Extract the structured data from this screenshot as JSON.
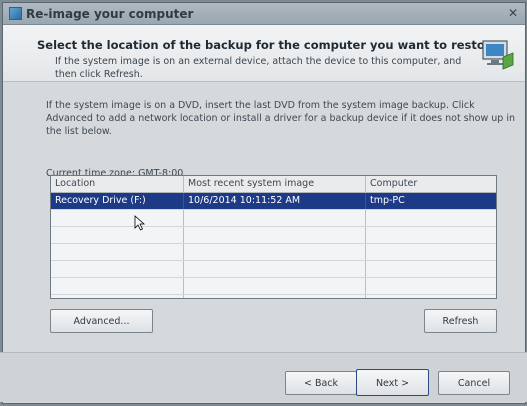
{
  "window": {
    "title": "Re-image your computer",
    "close_glyph": "✕"
  },
  "header": {
    "title": "Select the location of the backup for the computer you want to restore",
    "subtitle": "If the system image is on an external device, attach the device to this computer, and then click Refresh."
  },
  "body": {
    "instructions": "If the system image is on a DVD, insert the last DVD from the system image backup. Click Advanced to add a network location or install a driver for a backup device if it does not show up in the list below.",
    "timezone": "Current time zone: GMT-8:00"
  },
  "table": {
    "columns": [
      "Location",
      "Most recent system image",
      "Computer"
    ],
    "rows": [
      {
        "location": "Recovery Drive (F:)",
        "image": "10/6/2014 10:11:52 AM",
        "computer": "tmp-PC",
        "selected": true
      }
    ]
  },
  "buttons": {
    "advanced": "Advanced...",
    "refresh": "Refresh",
    "back": "< Back",
    "next": "Next >",
    "cancel": "Cancel"
  },
  "colors": {
    "selection": "#1d3a86",
    "titlebar": "#9aa6b0"
  },
  "icons": {
    "title": "backup-icon",
    "header": "computer-restore-icon",
    "cursor": "mouse-pointer-icon"
  }
}
